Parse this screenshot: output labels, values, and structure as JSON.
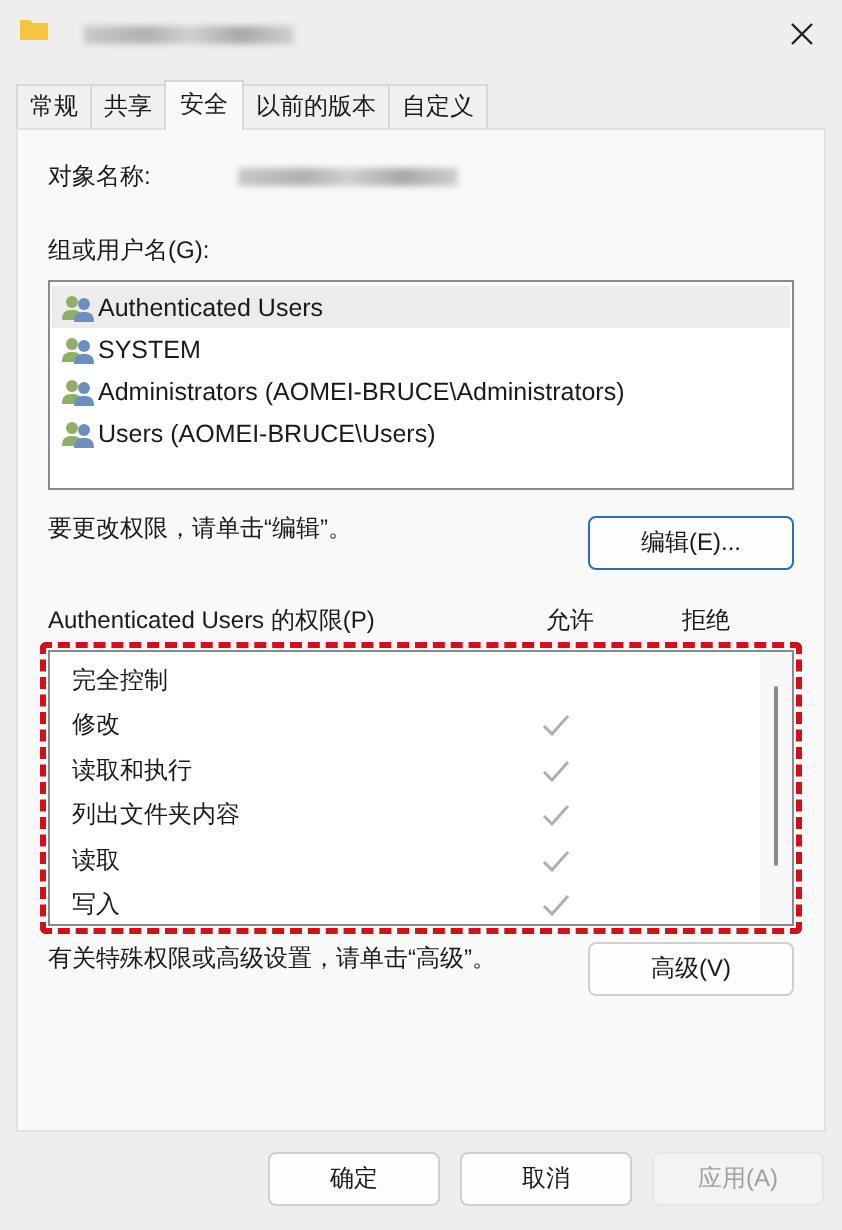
{
  "tabs": [
    {
      "label": "常规",
      "selected": false
    },
    {
      "label": "共享",
      "selected": false
    },
    {
      "label": "安全",
      "selected": true
    },
    {
      "label": "以前的版本",
      "selected": false
    },
    {
      "label": "自定义",
      "selected": false
    }
  ],
  "object_name_label": "对象名称:",
  "groups_label": "组或用户名(G):",
  "users": [
    {
      "name": "Authenticated Users",
      "selected": true
    },
    {
      "name": "SYSTEM",
      "selected": false
    },
    {
      "name": "Administrators (AOMEI-BRUCE\\Administrators)",
      "selected": false
    },
    {
      "name": "Users (AOMEI-BRUCE\\Users)",
      "selected": false
    }
  ],
  "edit_hint": "要更改权限，请单击“编辑”。",
  "edit_button": "编辑(E)...",
  "permissions_header": {
    "title": "Authenticated Users 的权限(P)",
    "allow": "允许",
    "deny": "拒绝"
  },
  "permissions": [
    {
      "name": "完全控制",
      "allow": false,
      "deny": false
    },
    {
      "name": "修改",
      "allow": true,
      "deny": false
    },
    {
      "name": "读取和执行",
      "allow": true,
      "deny": false
    },
    {
      "name": "列出文件夹内容",
      "allow": true,
      "deny": false
    },
    {
      "name": "读取",
      "allow": true,
      "deny": false
    },
    {
      "name": "写入",
      "allow": true,
      "deny": false
    }
  ],
  "advanced_hint": "有关特殊权限或高级设置，请单击“高级”。",
  "advanced_button": "高级(V)",
  "buttons": [
    {
      "label": "确定",
      "disabled": false
    },
    {
      "label": "取消",
      "disabled": false
    },
    {
      "label": "应用(A)",
      "disabled": true
    }
  ]
}
